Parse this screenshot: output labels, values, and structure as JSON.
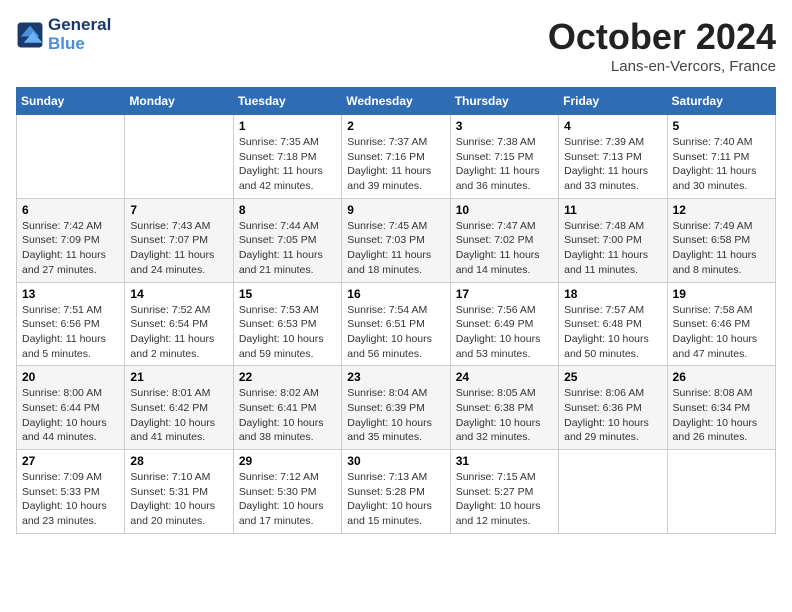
{
  "logo": {
    "line1": "General",
    "line2": "Blue"
  },
  "title": {
    "month_year": "October 2024",
    "location": "Lans-en-Vercors, France"
  },
  "days_of_week": [
    "Sunday",
    "Monday",
    "Tuesday",
    "Wednesday",
    "Thursday",
    "Friday",
    "Saturday"
  ],
  "weeks": [
    [
      {
        "day": "",
        "info": ""
      },
      {
        "day": "",
        "info": ""
      },
      {
        "day": "1",
        "sunrise": "7:35 AM",
        "sunset": "7:18 PM",
        "daylight": "11 hours and 42 minutes."
      },
      {
        "day": "2",
        "sunrise": "7:37 AM",
        "sunset": "7:16 PM",
        "daylight": "11 hours and 39 minutes."
      },
      {
        "day": "3",
        "sunrise": "7:38 AM",
        "sunset": "7:15 PM",
        "daylight": "11 hours and 36 minutes."
      },
      {
        "day": "4",
        "sunrise": "7:39 AM",
        "sunset": "7:13 PM",
        "daylight": "11 hours and 33 minutes."
      },
      {
        "day": "5",
        "sunrise": "7:40 AM",
        "sunset": "7:11 PM",
        "daylight": "11 hours and 30 minutes."
      }
    ],
    [
      {
        "day": "6",
        "sunrise": "7:42 AM",
        "sunset": "7:09 PM",
        "daylight": "11 hours and 27 minutes."
      },
      {
        "day": "7",
        "sunrise": "7:43 AM",
        "sunset": "7:07 PM",
        "daylight": "11 hours and 24 minutes."
      },
      {
        "day": "8",
        "sunrise": "7:44 AM",
        "sunset": "7:05 PM",
        "daylight": "11 hours and 21 minutes."
      },
      {
        "day": "9",
        "sunrise": "7:45 AM",
        "sunset": "7:03 PM",
        "daylight": "11 hours and 18 minutes."
      },
      {
        "day": "10",
        "sunrise": "7:47 AM",
        "sunset": "7:02 PM",
        "daylight": "11 hours and 14 minutes."
      },
      {
        "day": "11",
        "sunrise": "7:48 AM",
        "sunset": "7:00 PM",
        "daylight": "11 hours and 11 minutes."
      },
      {
        "day": "12",
        "sunrise": "7:49 AM",
        "sunset": "6:58 PM",
        "daylight": "11 hours and 8 minutes."
      }
    ],
    [
      {
        "day": "13",
        "sunrise": "7:51 AM",
        "sunset": "6:56 PM",
        "daylight": "11 hours and 5 minutes."
      },
      {
        "day": "14",
        "sunrise": "7:52 AM",
        "sunset": "6:54 PM",
        "daylight": "11 hours and 2 minutes."
      },
      {
        "day": "15",
        "sunrise": "7:53 AM",
        "sunset": "6:53 PM",
        "daylight": "10 hours and 59 minutes."
      },
      {
        "day": "16",
        "sunrise": "7:54 AM",
        "sunset": "6:51 PM",
        "daylight": "10 hours and 56 minutes."
      },
      {
        "day": "17",
        "sunrise": "7:56 AM",
        "sunset": "6:49 PM",
        "daylight": "10 hours and 53 minutes."
      },
      {
        "day": "18",
        "sunrise": "7:57 AM",
        "sunset": "6:48 PM",
        "daylight": "10 hours and 50 minutes."
      },
      {
        "day": "19",
        "sunrise": "7:58 AM",
        "sunset": "6:46 PM",
        "daylight": "10 hours and 47 minutes."
      }
    ],
    [
      {
        "day": "20",
        "sunrise": "8:00 AM",
        "sunset": "6:44 PM",
        "daylight": "10 hours and 44 minutes."
      },
      {
        "day": "21",
        "sunrise": "8:01 AM",
        "sunset": "6:42 PM",
        "daylight": "10 hours and 41 minutes."
      },
      {
        "day": "22",
        "sunrise": "8:02 AM",
        "sunset": "6:41 PM",
        "daylight": "10 hours and 38 minutes."
      },
      {
        "day": "23",
        "sunrise": "8:04 AM",
        "sunset": "6:39 PM",
        "daylight": "10 hours and 35 minutes."
      },
      {
        "day": "24",
        "sunrise": "8:05 AM",
        "sunset": "6:38 PM",
        "daylight": "10 hours and 32 minutes."
      },
      {
        "day": "25",
        "sunrise": "8:06 AM",
        "sunset": "6:36 PM",
        "daylight": "10 hours and 29 minutes."
      },
      {
        "day": "26",
        "sunrise": "8:08 AM",
        "sunset": "6:34 PM",
        "daylight": "10 hours and 26 minutes."
      }
    ],
    [
      {
        "day": "27",
        "sunrise": "7:09 AM",
        "sunset": "5:33 PM",
        "daylight": "10 hours and 23 minutes."
      },
      {
        "day": "28",
        "sunrise": "7:10 AM",
        "sunset": "5:31 PM",
        "daylight": "10 hours and 20 minutes."
      },
      {
        "day": "29",
        "sunrise": "7:12 AM",
        "sunset": "5:30 PM",
        "daylight": "10 hours and 17 minutes."
      },
      {
        "day": "30",
        "sunrise": "7:13 AM",
        "sunset": "5:28 PM",
        "daylight": "10 hours and 15 minutes."
      },
      {
        "day": "31",
        "sunrise": "7:15 AM",
        "sunset": "5:27 PM",
        "daylight": "10 hours and 12 minutes."
      },
      {
        "day": "",
        "info": ""
      },
      {
        "day": "",
        "info": ""
      }
    ]
  ],
  "labels": {
    "sunrise": "Sunrise:",
    "sunset": "Sunset:",
    "daylight": "Daylight:"
  }
}
